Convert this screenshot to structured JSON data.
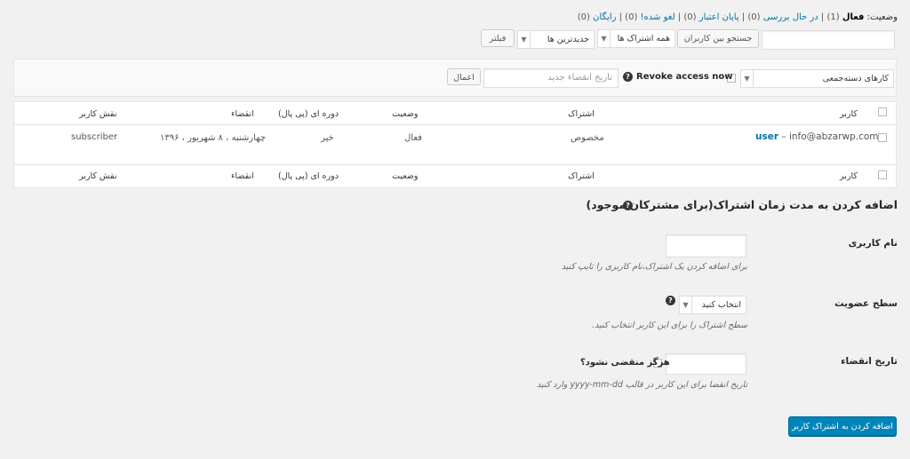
{
  "status_filter": {
    "label": "وضعیت:",
    "items": [
      {
        "text": "فعال",
        "count": "(1)"
      },
      {
        "text": "در حال بررسی",
        "count": "(0)"
      },
      {
        "text": "پایان اعتبار",
        "count": "(0)"
      },
      {
        "text": "لغو شده!",
        "count": "(0)"
      },
      {
        "text": "رایگان",
        "count": "(0)"
      }
    ]
  },
  "toolbar": {
    "search_button": "جستجو بین کاربران",
    "subscriptions_select": "همه اشتراک ها",
    "order_select": "جدیدترین ها",
    "filter_button": "فیلتر"
  },
  "bulk": {
    "select": "کارهای دسته‌جمعی",
    "revoke_label": "Revoke access now",
    "help_icon": "?",
    "expiry_placeholder": "تاریخ انقضاء جدید",
    "apply_button": "اعمال"
  },
  "table": {
    "headers": {
      "user": "کاربر",
      "subscription": "اشتراک",
      "status": "وضعیت",
      "period": "دوره ای (پی پال)",
      "expiry": "انقضاء",
      "role": "نقش کاربر"
    },
    "row": {
      "user_link": "user",
      "user_email": "– info@abzarwp.com",
      "subscription": "مخصوص",
      "status": "فعال",
      "period": "خیر",
      "expiry": "چهارشنبه ، ۸ شهریور ، ۱۳۹۶",
      "role": "subscriber"
    }
  },
  "add_form": {
    "title": "اضافه کردن به مدت زمان اشتراک(برای مشترکان موجود)",
    "username_label": "نام کاربری",
    "username_desc": "برای اضافه کردن یک اشتراک،نام کاربری را تایپ کنید",
    "level_label": "سطح عضویت",
    "level_select": "انتخاب کنید",
    "level_desc": "سطح اشتراک را برای این کاربر انتخاب کنید.",
    "expiry_label": "تاریخ انقضاء",
    "never_expire": "هرگز منقضی نشود؟",
    "expiry_desc": "تاریخ انقضا برای این کاربر در قالب yyyy-mm-dd وارد کنید",
    "submit_button": "اضافه کردن به اشتراک کاربر"
  },
  "colors": {
    "link": "#0073aa",
    "primary": "#0085ba",
    "background": "#f1f1f1"
  }
}
